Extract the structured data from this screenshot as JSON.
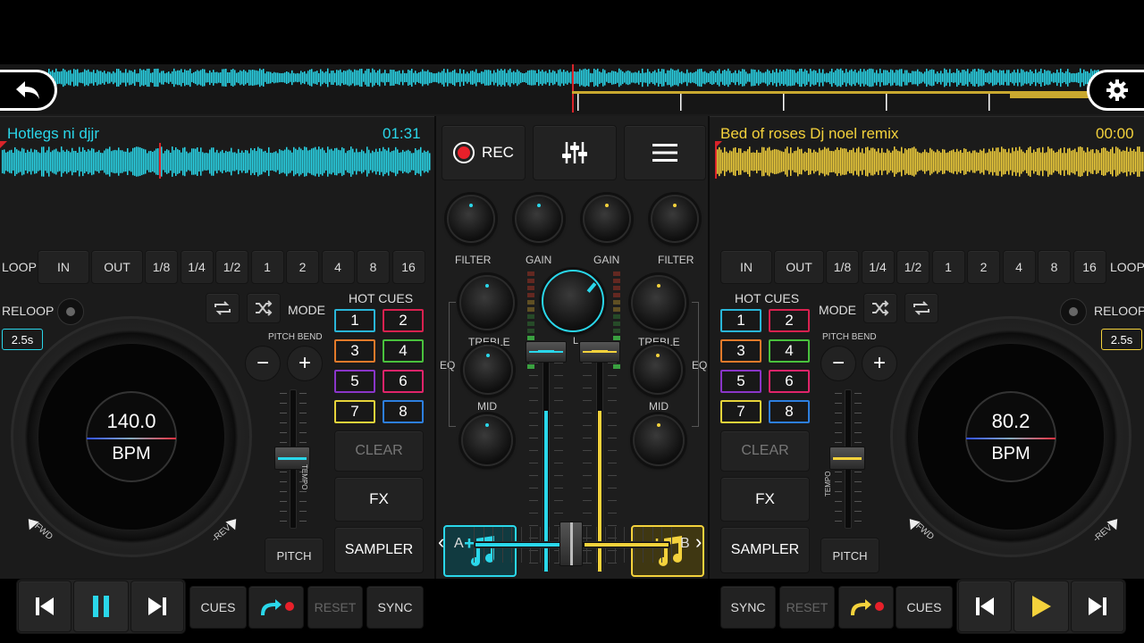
{
  "overview": {
    "back": "back",
    "settings": "settings"
  },
  "left": {
    "title": "Hotlegs ni djjr",
    "time": "01:31",
    "loop": "LOOP",
    "in": "IN",
    "out": "OUT",
    "sizes": [
      "1/8",
      "1/4",
      "1/2",
      "1",
      "2",
      "4",
      "8",
      "16"
    ],
    "reloop": "RELOOP",
    "reloop_len": "2.5s",
    "mode": "MODE",
    "hot_cues": "HOT CUES",
    "pitch_bend": "PITCH BEND",
    "cues": [
      "1",
      "2",
      "3",
      "4",
      "5",
      "6",
      "7",
      "8"
    ],
    "clear": "CLEAR",
    "fx": "FX",
    "sampler": "SAMPLER",
    "pitch": "PITCH",
    "tempo": "TEMPO",
    "bpm": "140.0",
    "bpm_unit": "BPM",
    "fwd": "+FWD",
    "rev": "-REV",
    "cues_btn": "CUES",
    "reset": "RESET",
    "sync": "SYNC",
    "minus": "−",
    "plus": "+"
  },
  "right": {
    "title": "Bed of roses Dj noel remix",
    "time": "00:00",
    "loop": "LOOP",
    "in": "IN",
    "out": "OUT",
    "sizes": [
      "1/8",
      "1/4",
      "1/2",
      "1",
      "2",
      "4",
      "8",
      "16"
    ],
    "reloop": "RELOOP",
    "reloop_len": "2.5s",
    "mode": "MODE",
    "hot_cues": "HOT CUES",
    "pitch_bend": "PITCH BEND",
    "cues": [
      "1",
      "2",
      "3",
      "4",
      "5",
      "6",
      "7",
      "8"
    ],
    "clear": "CLEAR",
    "fx": "FX",
    "sampler": "SAMPLER",
    "pitch": "PITCH",
    "tempo": "TEMPO",
    "bpm": "80.2",
    "bpm_unit": "BPM",
    "fwd": "+FWD",
    "rev": "-REV",
    "cues_btn": "CUES",
    "reset": "RESET",
    "sync": "SYNC",
    "minus": "−",
    "plus": "+"
  },
  "mixer": {
    "rec": "REC",
    "filter": "FILTER",
    "gain": "GAIN",
    "treble": "TREBLE",
    "mid": "MID",
    "eq": "EQ",
    "a": "A",
    "b": "B",
    "master_label": "L",
    "left_arrow": "‹",
    "right_arrow": "›"
  },
  "colors": {
    "deckA": "#2ad7ea",
    "deckB": "#f4d23c",
    "rec": "#e8202a"
  },
  "hot_cue_colors": [
    "#29b6d8",
    "#d8214f",
    "#e27a2a",
    "#49c13d",
    "#8a35c9",
    "#e0246a",
    "#e6d33a",
    "#2d7fe0"
  ]
}
